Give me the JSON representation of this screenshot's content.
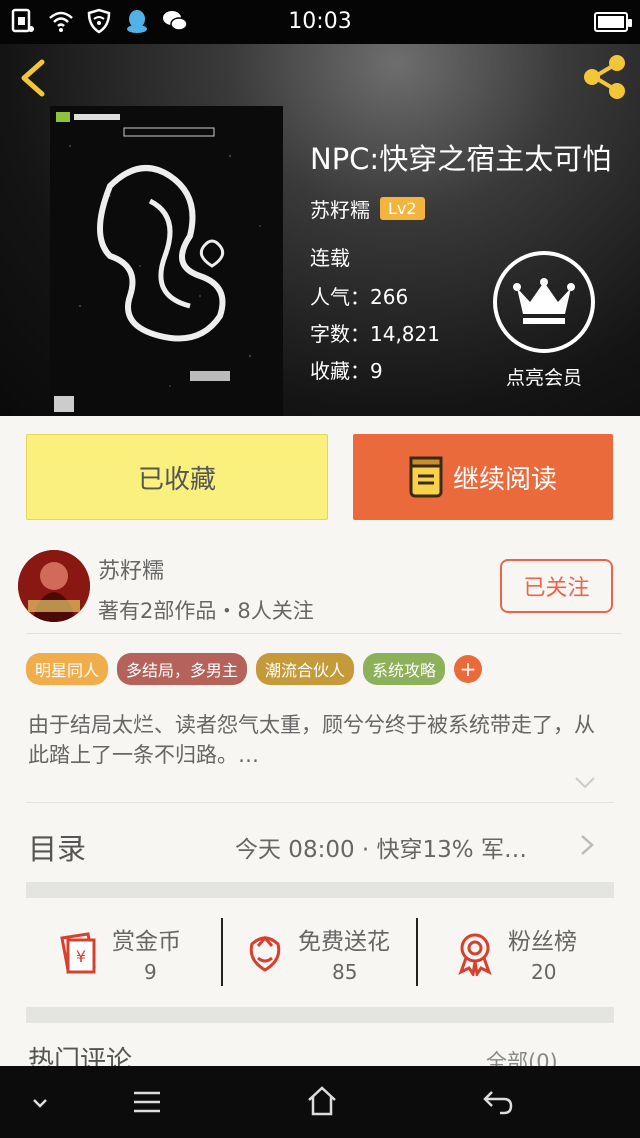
{
  "status_bar": {
    "time": "10:03",
    "icons": [
      "sim-icon",
      "wifi-icon",
      "shield-wifi-icon",
      "qq-icon",
      "wechat-icon",
      "battery-icon"
    ]
  },
  "header": {
    "back_icon": "chevron-left-icon",
    "share_icon": "share-icon",
    "title": "NPC:快穿之宿主太可怕",
    "author": "苏籽糯",
    "level_badge": "Lv2",
    "status": "连载",
    "popularity": "人气：266",
    "word_count": "字数：14,821",
    "favorites": "收藏：9",
    "vip_label": "点亮会员",
    "accent": "#f2b43c"
  },
  "actions": {
    "favorited_label": "已收藏",
    "continue_label": "继续阅读",
    "favorited_color": "#f9f07e",
    "continue_color": "#ea6a3c"
  },
  "author_card": {
    "name": "苏籽糯",
    "stats": "著有2部作品・8人关注",
    "follow_label": "已关注"
  },
  "tags": [
    {
      "label": "明星同人",
      "color": "#f1ac4b"
    },
    {
      "label": "多结局，多男主",
      "color": "#b5625a"
    },
    {
      "label": "潮流合伙人",
      "color": "#c49a3a"
    },
    {
      "label": "系统攻略",
      "color": "#8db05a"
    }
  ],
  "tag_add_label": "+",
  "synopsis": "由于结局太烂、读者怨气太重，顾兮兮终于被系统带走了，从此踏上了一条不归路。…",
  "toc": {
    "title": "目录",
    "latest": "今天 08:00 · 快穿13% 军…"
  },
  "stats": [
    {
      "label": "赏金币",
      "value": "9",
      "icon": "red-envelope-icon"
    },
    {
      "label": "免费送花",
      "value": "85",
      "icon": "flower-icon"
    },
    {
      "label": "粉丝榜",
      "value": "20",
      "icon": "medal-icon"
    }
  ],
  "comments": {
    "title": "热门评论",
    "all_link": "全部(0)"
  },
  "nav_bar": {
    "icons": [
      "chevron-down-icon",
      "menu-icon",
      "home-icon",
      "back-icon"
    ]
  }
}
